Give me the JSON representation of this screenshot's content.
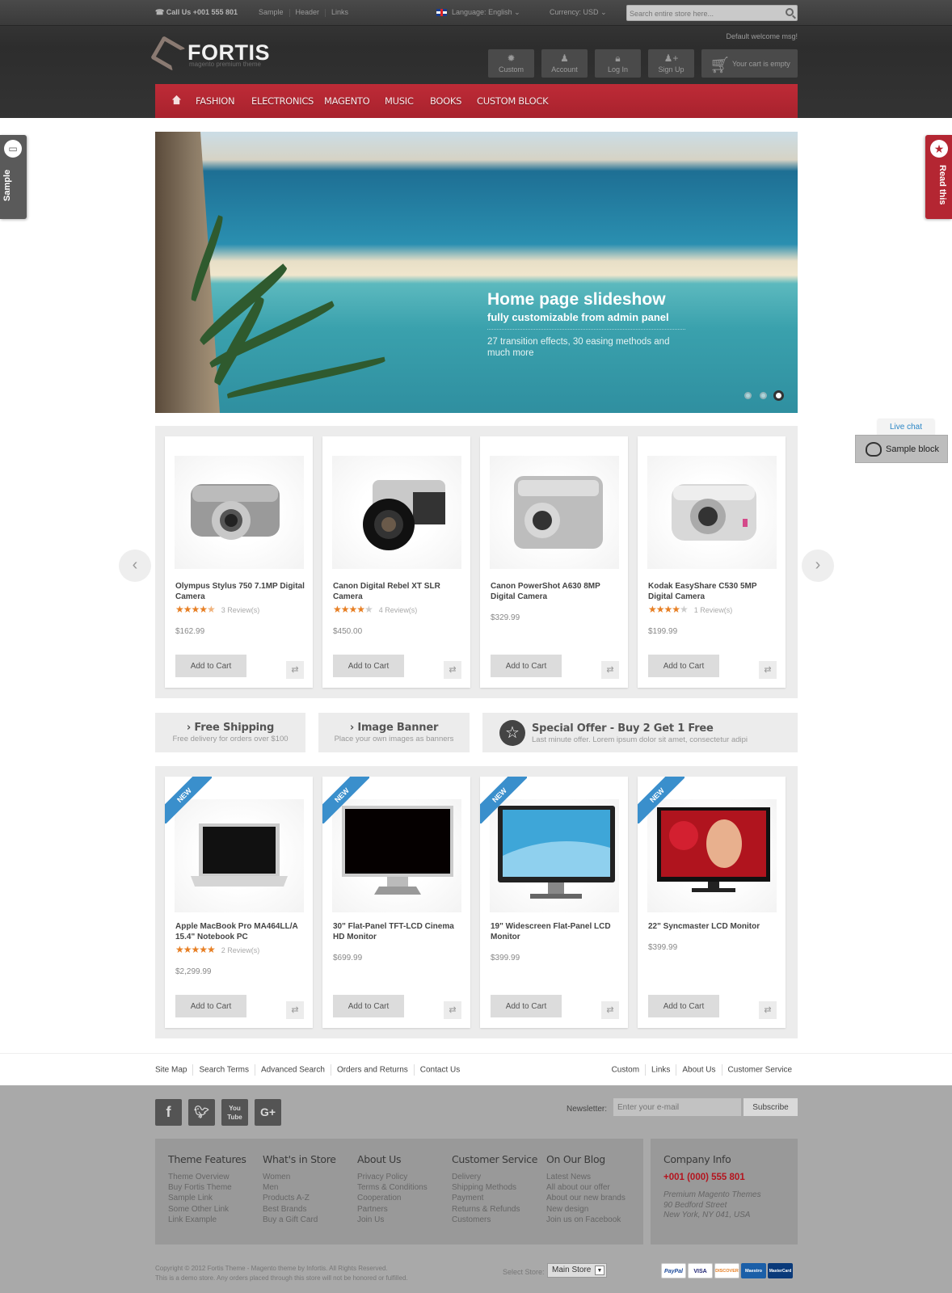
{
  "topbar": {
    "call": "Call Us +001 555 801",
    "links": [
      "Sample",
      "Header",
      "Links"
    ],
    "language_label": "Language:",
    "language_value": "English",
    "currency_label": "Currency:",
    "currency_value": "USD",
    "search_placeholder": "Search entire store here..."
  },
  "header": {
    "logo_text": "FORTIS",
    "logo_sub": "magento premium theme",
    "welcome": "Default welcome msg!",
    "buttons": [
      {
        "label": "Custom",
        "icon": "gear-icon"
      },
      {
        "label": "Account",
        "icon": "user-icon"
      },
      {
        "label": "Log In",
        "icon": "lock-icon"
      },
      {
        "label": "Sign Up",
        "icon": "user-plus-icon"
      }
    ],
    "cart": "Your cart is empty"
  },
  "nav": {
    "items": [
      "FASHION",
      "ELECTRONICS",
      "MAGENTO",
      "MUSIC",
      "BOOKS",
      "CUSTOM BLOCK"
    ],
    "accent": "#b42632"
  },
  "slider": {
    "title": "Home page slideshow",
    "subtitle": "fully customizable from admin panel",
    "description": "27 transition effects, 30 easing methods and much more",
    "slides": 3,
    "active_slide": 3
  },
  "side_tabs": {
    "left": "Sample",
    "right": "Read this"
  },
  "chat": {
    "bubble": "Live chat",
    "block": "Sample block"
  },
  "featured": [
    {
      "name": "Olympus Stylus 750 7.1MP Digital Camera",
      "rating": 4.5,
      "reviews": "3 Review(s)",
      "price": "$162.99"
    },
    {
      "name": "Canon Digital Rebel XT SLR Camera",
      "rating": 4,
      "reviews": "4 Review(s)",
      "price": "$450.00"
    },
    {
      "name": "Canon PowerShot A630 8MP Digital Camera",
      "rating": null,
      "reviews": "",
      "price": "$329.99"
    },
    {
      "name": "Kodak EasyShare C530 5MP Digital Camera",
      "rating": 4,
      "reviews": "1 Review(s)",
      "price": "$199.99"
    }
  ],
  "new_products": [
    {
      "name": "Apple MacBook Pro MA464LL/A 15.4\" Notebook PC",
      "rating": 5,
      "reviews": "2 Review(s)",
      "price": "$2,299.99",
      "badge": "NEW"
    },
    {
      "name": "30\" Flat-Panel TFT-LCD Cinema HD Monitor",
      "rating": null,
      "reviews": "",
      "price": "$699.99",
      "badge": "NEW"
    },
    {
      "name": "19\" Widescreen Flat-Panel LCD Monitor",
      "rating": null,
      "reviews": "",
      "price": "$399.99",
      "badge": "NEW"
    },
    {
      "name": "22\" Syncmaster LCD Monitor",
      "rating": null,
      "reviews": "",
      "price": "$399.99",
      "badge": "NEW"
    }
  ],
  "add_to_cart": "Add to Cart",
  "banners": [
    {
      "title": "Free Shipping",
      "text": "Free delivery for orders over $100"
    },
    {
      "title": "Image Banner",
      "text": "Place your own images as banners"
    },
    {
      "title": "Special Offer - Buy 2 Get 1 Free",
      "text": "Last minute offer. Lorem ipsum dolor sit amet, consectetur adipi"
    }
  ],
  "footer_links": {
    "left": [
      "Site Map",
      "Search Terms",
      "Advanced Search",
      "Orders and Returns",
      "Contact Us"
    ],
    "right": [
      "Custom",
      "Links",
      "About Us",
      "Customer Service"
    ]
  },
  "social": [
    "f",
    "t",
    "You Tube",
    "G+"
  ],
  "newsletter": {
    "label": "Newsletter:",
    "placeholder": "Enter your e-mail",
    "button": "Subscribe"
  },
  "footer_columns": [
    {
      "heading": "Theme Features",
      "links": [
        "Theme Overview",
        "Buy Fortis Theme",
        "Sample Link",
        "Some Other Link",
        "Link Example"
      ]
    },
    {
      "heading": "What's in Store",
      "links": [
        "Women",
        "Men",
        "Products A-Z",
        "Best Brands",
        "Buy a Gift Card"
      ]
    },
    {
      "heading": "About Us",
      "links": [
        "Privacy Policy",
        "Terms & Conditions",
        "Cooperation",
        "Partners",
        "Join Us"
      ]
    },
    {
      "heading": "Customer Service",
      "links": [
        "Delivery",
        "Shipping Methods",
        "Payment",
        "Returns & Refunds",
        "Customers"
      ]
    },
    {
      "heading": "On Our Blog",
      "links": [
        "Latest News",
        "All about our offer",
        "About our new brands",
        "New design",
        "Join us on Facebook"
      ]
    }
  ],
  "company": {
    "heading": "Company Info",
    "phone": "+001 (000) 555 801",
    "address": [
      "Premium Magento Themes",
      "90 Bedford Street",
      "New York, NY 041, USA"
    ]
  },
  "copyright": [
    "Copyright © 2012 Fortis Theme - Magento theme by Infortis. All Rights Reserved.",
    "This is a demo store. Any orders placed through this store will not be honored or fulfilled."
  ],
  "store_select": {
    "label": "Select Store:",
    "value": "Main Store"
  },
  "payment_icons": [
    "PayPal",
    "VISA",
    "DISCOVER",
    "Maestro",
    "MasterCard"
  ]
}
